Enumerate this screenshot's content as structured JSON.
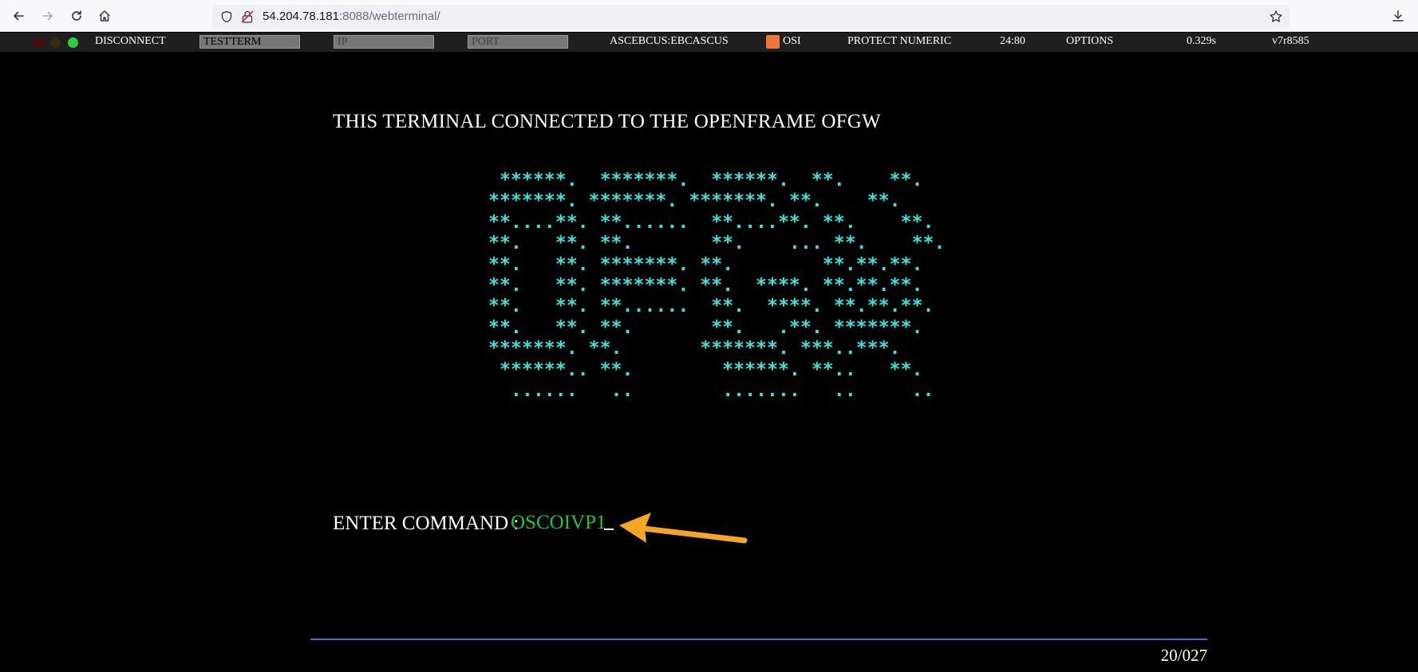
{
  "browser": {
    "url_host": "54.204.78.181",
    "url_path": ":8088/webterminal/"
  },
  "toolbar": {
    "disconnect_label": "DISCONNECT",
    "terminal_value": "TESTTERM",
    "ip_placeholder": "IP",
    "port_placeholder": "PORT",
    "system_label": "ASCEBCUS:EBCASCUS",
    "osi_label": "OSI",
    "protect_label": "PROTECT NUMERIC",
    "size_label": "24:80",
    "options_label": "OPTIONS",
    "response_time": "0.329s",
    "version": "v7r8585",
    "status_colors": [
      "#4a0d0d",
      "#3a2a10",
      "#2ecc40"
    ]
  },
  "screen": {
    "banner": "THIS TERMINAL CONNECTED TO THE OPENFRAME OFGW",
    "logo_art": " ******.  *******.  ******.  **.    **.\n*******. *******. *******. **.    **.\n**....**. **......  **....**. **.    **.\n**.   **. **.       **.    ... **.    **.\n**.   **. *******. **.        **.**.**.\n**.   **. *******. **.  ****. **.**.**.\n**.   **. **......  **.  ****. **.**.**.\n**.   **. **.       **.   .**. *******.\n*******. **.       *******. ***..***.\n ******.. **.        ******. **..   **.\n  ......   ..        .......   ..     ..",
    "command_label": "ENTER COMMAND  :",
    "command_value": "OSCOIVP1",
    "cursor_position": "20/027",
    "colors": {
      "logo": "#3be0d8",
      "command": "#22c33a",
      "divider": "#3c6fd1",
      "annotation": "#f5a623"
    }
  }
}
